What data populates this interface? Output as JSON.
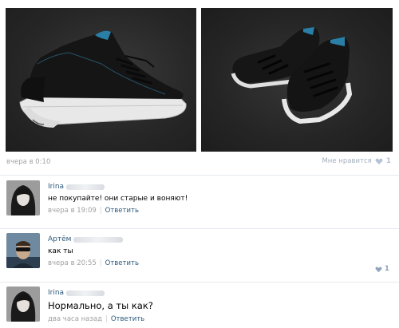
{
  "post": {
    "time": "вчера в 0:10",
    "like_label": "Мне нравится",
    "like_count": "1",
    "like_icon": "heart-icon"
  },
  "comments": [
    {
      "author": "Irina",
      "text": "не покупайте! они старые и воняют!",
      "time": "вчера в 19:09",
      "reply_label": "Ответить",
      "likes": ""
    },
    {
      "author": "Артём",
      "text": "как ты",
      "time": "вчера в 20:55",
      "reply_label": "Ответить",
      "likes": "1"
    },
    {
      "author": "Irina",
      "text": "Нормально, а ты как?",
      "time": "два часа назад",
      "reply_label": "Ответить",
      "likes": ""
    }
  ],
  "colors": {
    "link": "#2b587a",
    "meta": "#a0a0a0",
    "like": "#8fa4be",
    "accent_shoe": "#2a7fa6"
  }
}
